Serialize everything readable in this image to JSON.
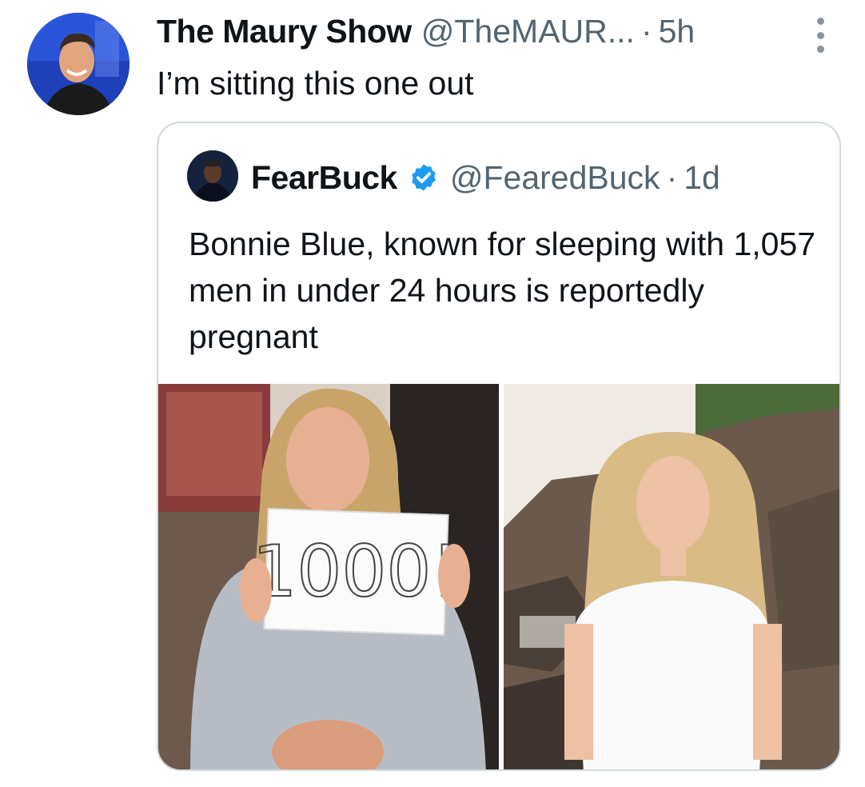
{
  "tweet": {
    "author_name": "The Maury Show",
    "author_handle": "@TheMAUR...",
    "separator": "·",
    "time": "5h",
    "text": "I’m sitting this one out",
    "avatar_icon": "avatar-maury",
    "more_icon": "vertical-ellipsis-icon"
  },
  "quoted": {
    "author_name": "FearBuck",
    "author_handle": "@FearedBuck",
    "separator": "·",
    "time": "1d",
    "verified_icon": "verified-badge-icon",
    "text": "Bonnie Blue, known for sleeping with 1,057 men in under 24 hours is reportedly pregnant",
    "photos": [
      {
        "description_icon": "photo-woman-holding-sign",
        "sign_text": "1000!"
      },
      {
        "description_icon": "photo-woman-on-rocks"
      }
    ]
  },
  "colors": {
    "text": "#0f1419",
    "secondary": "#536471",
    "border": "#cfd9de",
    "verified": "#1d9bf0"
  }
}
